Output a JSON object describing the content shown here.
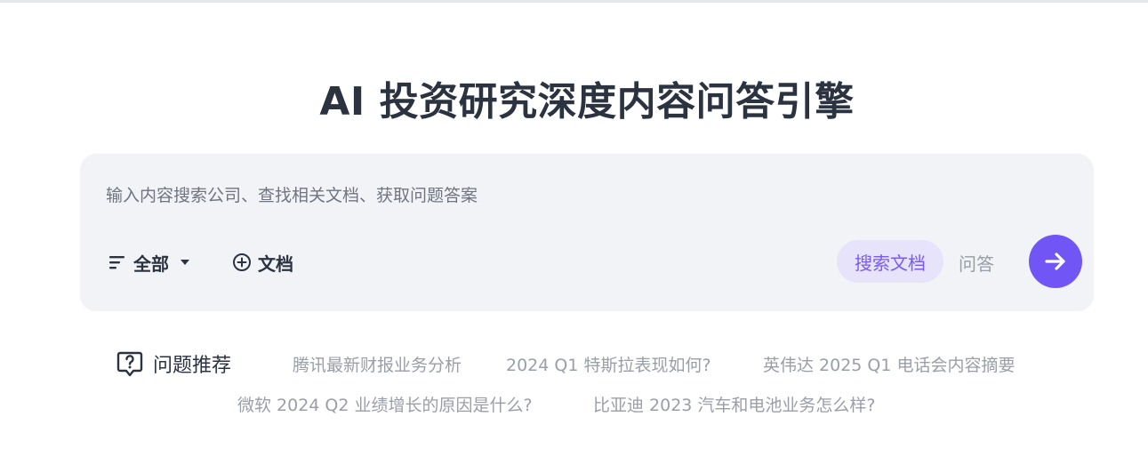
{
  "header": {
    "title": "AI 投资研究深度内容问答引擎"
  },
  "search": {
    "placeholder": "输入内容搜索公司、查找相关文档、获取问题答案",
    "value": "",
    "filter_label": "全部",
    "doc_label": "文档",
    "mode_search_label": "搜索文档",
    "mode_qa_label": "问答",
    "active_mode": "搜索文档"
  },
  "recommend": {
    "label": "问题推荐",
    "items": [
      "腾讯最新财报业务分析",
      "2024 Q1 特斯拉表现如何?",
      "英伟达 2025 Q1 电话会内容摘要",
      "微软 2024 Q2 业绩增长的原因是什么?",
      "比亚迪 2023 汽车和电池业务怎么样?"
    ]
  },
  "colors": {
    "accent": "#7156f5",
    "accent_soft": "#e6e3fb",
    "card_bg": "#f2f3f7",
    "title_text": "#2b3240",
    "muted_text": "#9a9ea8"
  },
  "icons": {
    "filter": "filter-lines-icon",
    "caret": "caret-down-icon",
    "add_doc": "plus-circle-icon",
    "submit": "arrow-right-icon",
    "recommend": "question-bubble-icon"
  }
}
